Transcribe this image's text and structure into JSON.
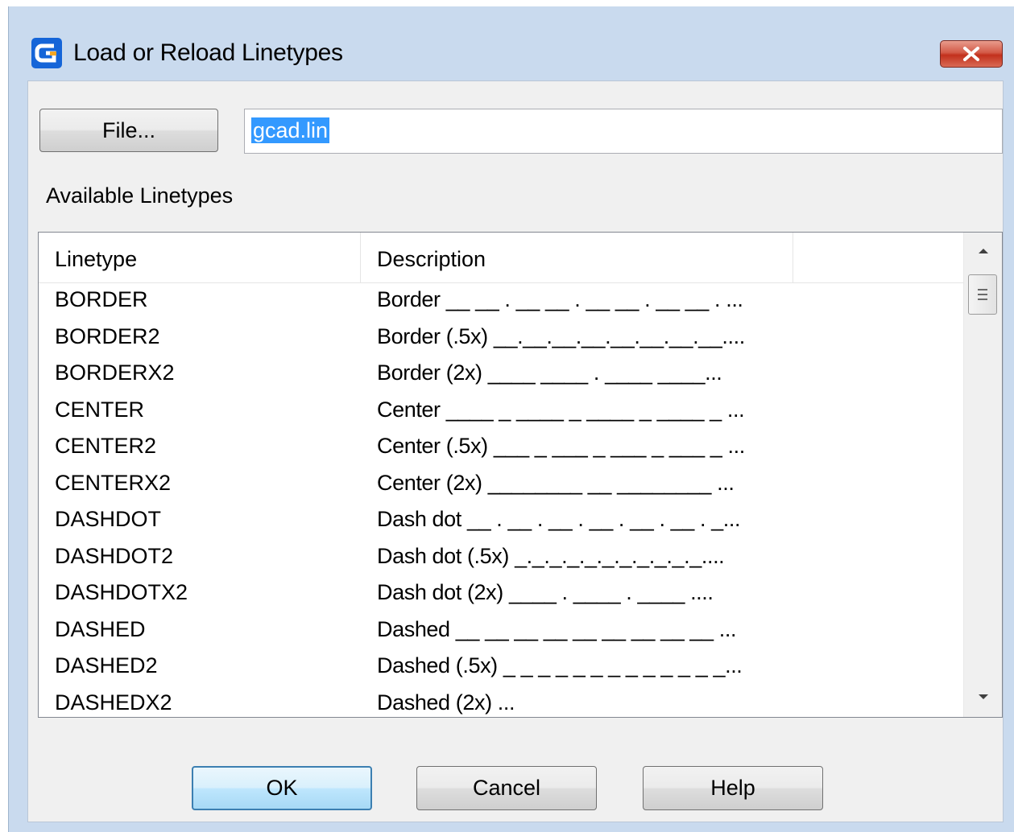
{
  "window": {
    "title": "Load or Reload Linetypes"
  },
  "file": {
    "button_label": "File...",
    "path_value": "gcad.lin"
  },
  "available_label": "Available Linetypes",
  "table": {
    "columns": [
      "Linetype",
      "Description",
      ""
    ],
    "rows": [
      {
        "linetype": "BORDER",
        "description": "Border __ __ . __ __ . __ __ . __ __ . ..."
      },
      {
        "linetype": "BORDER2",
        "description": "Border (.5x) __.__.__.__.__.__.__.__...."
      },
      {
        "linetype": "BORDERX2",
        "description": "Border (2x) ____  ____  .  ____  ____..."
      },
      {
        "linetype": "CENTER",
        "description": "Center ____ _ ____ _ ____ _ ____ _ ..."
      },
      {
        "linetype": "CENTER2",
        "description": "Center (.5x) ___ _ ___ _ ___ _ ___ _ ..."
      },
      {
        "linetype": "CENTERX2",
        "description": "Center (2x) ________  __  ________ ..."
      },
      {
        "linetype": "DASHDOT",
        "description": "Dash dot __ . __ . __ . __ . __ . __ . _..."
      },
      {
        "linetype": "DASHDOT2",
        "description": "Dash dot (.5x) _._._._._._._._._._._...."
      },
      {
        "linetype": "DASHDOTX2",
        "description": "Dash dot (2x) ____  .  ____  .  ____  ...."
      },
      {
        "linetype": "DASHED",
        "description": "Dashed __ __ __ __ __ __ __ __ __ ..."
      },
      {
        "linetype": "DASHED2",
        "description": "Dashed (.5x) _ _ _ _ _ _ _ _ _ _ _ _ _..."
      },
      {
        "linetype": "DASHEDX2",
        "description": "Dashed (2x)                          ..."
      }
    ]
  },
  "buttons": {
    "ok": "OK",
    "cancel": "Cancel",
    "help": "Help"
  },
  "colors": {
    "frame": "#c9daee",
    "client": "#f0f0f0",
    "selection": "#3399ff",
    "close": "#c2301c"
  },
  "icons": {
    "app": "gstarcad-logo-icon",
    "close": "close-icon",
    "scroll_up": "scroll-up-arrow-icon",
    "scroll_down": "scroll-down-arrow-icon",
    "thumb_grip": "scroll-grip-icon"
  }
}
